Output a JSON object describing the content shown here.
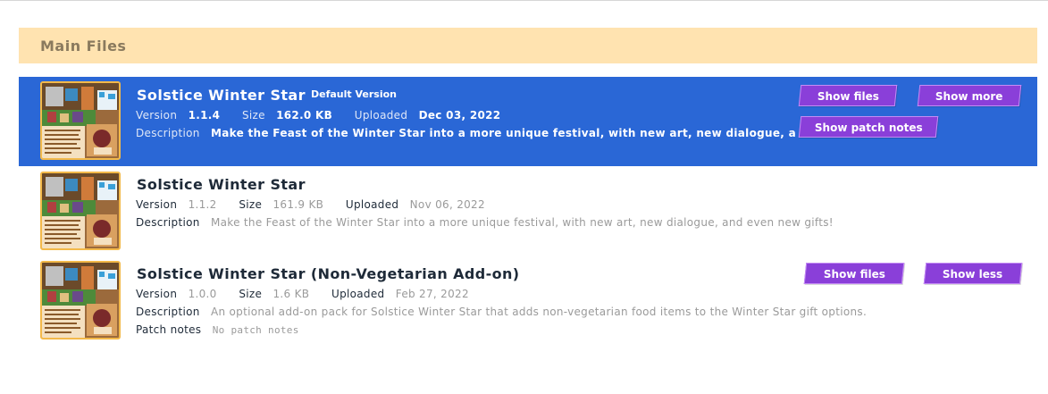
{
  "section": {
    "title": "Main Files"
  },
  "labels": {
    "version": "Version",
    "size": "Size",
    "uploaded": "Uploaded",
    "description": "Description",
    "patch_notes": "Patch notes"
  },
  "files": [
    {
      "title": "Solstice Winter Star",
      "badge": "Default Version",
      "version": "1.1.4",
      "size": "162.0 KB",
      "uploaded": "Dec 03, 2022",
      "description": "Make the Feast of the Winter Star into a more unique festival, with new art, new dialogue, and even new gifts!",
      "buttons": [
        "Show files",
        "Show more",
        "Show patch notes"
      ]
    },
    {
      "title": "Solstice Winter Star",
      "version": "1.1.2",
      "size": "161.9 KB",
      "uploaded": "Nov 06, 2022",
      "description": "Make the Feast of the Winter Star into a more unique festival, with new art, new dialogue, and even new gifts!"
    },
    {
      "title": "Solstice Winter Star (Non-Vegetarian Add-on)",
      "version": "1.0.0",
      "size": "1.6 KB",
      "uploaded": "Feb 27, 2022",
      "description": "An optional add-on pack for Solstice Winter Star that adds non-vegetarian food items to the Winter Star gift options.",
      "patch_notes": "No patch notes",
      "buttons": [
        "Show files",
        "Show less"
      ]
    }
  ],
  "colors": {
    "selected_bg": "#2a67d6",
    "header_bg": "#ffe3b0",
    "button_bg": "#8a3fd9"
  }
}
